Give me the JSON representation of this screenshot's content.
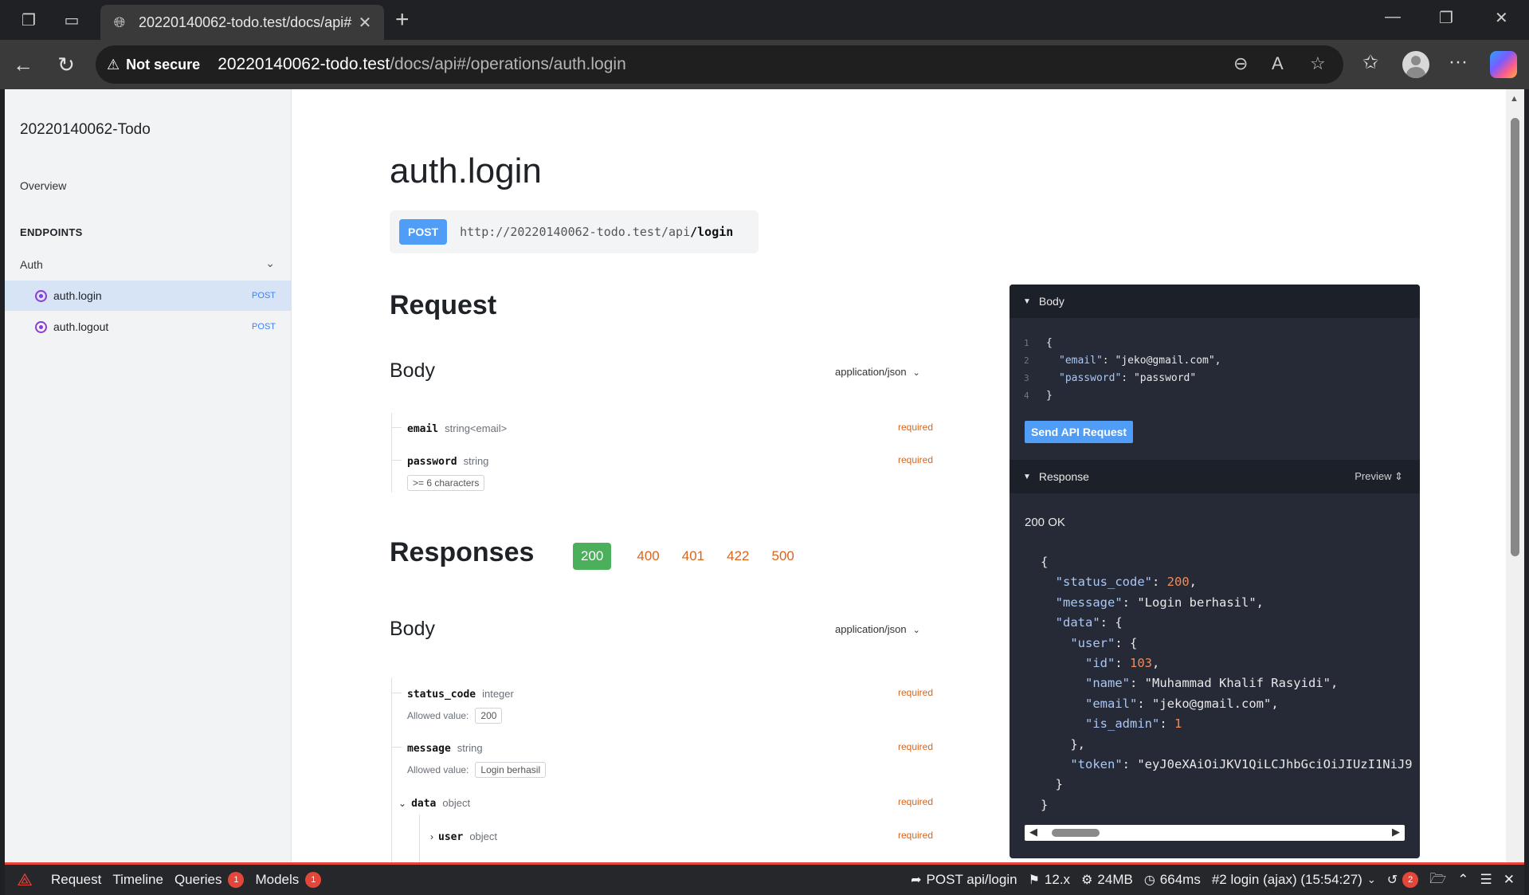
{
  "browser": {
    "tab_title": "20220140062-todo.test/docs/api#",
    "security": "Not secure",
    "url_host": "20220140062-todo.test",
    "url_path": "/docs/api#/operations/auth.login"
  },
  "sidebar": {
    "brand": "20220140062-Todo",
    "overview": "Overview",
    "endpoints_heading": "ENDPOINTS",
    "group": "Auth",
    "items": [
      {
        "label": "auth.login",
        "method": "POST"
      },
      {
        "label": "auth.logout",
        "method": "POST"
      }
    ]
  },
  "main": {
    "title": "auth.login",
    "method": "POST",
    "url_base": "http://20220140062-todo.test/api",
    "url_path": "/login",
    "request_heading": "Request",
    "body_heading": "Body",
    "content_type": "application/json",
    "request_fields": [
      {
        "name": "email",
        "type": "string<email>",
        "required": "required"
      },
      {
        "name": "password",
        "type": "string",
        "required": "required",
        "constraint": ">= 6 characters"
      }
    ],
    "responses_heading": "Responses",
    "status_codes": [
      "200",
      "400",
      "401",
      "422",
      "500"
    ],
    "response_body_heading": "Body",
    "response_content_type": "application/json",
    "allowed_value_label": "Allowed value:",
    "response_fields": [
      {
        "name": "status_code",
        "type": "integer",
        "required": "required",
        "allowed": "200"
      },
      {
        "name": "message",
        "type": "string",
        "required": "required",
        "allowed": "Login berhasil"
      },
      {
        "name": "data",
        "type": "object",
        "required": "required"
      },
      {
        "name": "user",
        "type": "object",
        "required": "required"
      }
    ]
  },
  "panel": {
    "body_label": "Body",
    "request_json": [
      {
        "ln": "1",
        "text": "{"
      },
      {
        "ln": "2",
        "key": "\"email\"",
        "value": "\"jeko@gmail.com\","
      },
      {
        "ln": "3",
        "key": "\"password\"",
        "value": "\"password\""
      },
      {
        "ln": "4",
        "text": "}"
      }
    ],
    "send_button": "Send API Request",
    "response_label": "Response",
    "preview_label": "Preview",
    "status": "200 OK",
    "response": {
      "status_code": "200",
      "message": "\"Login berhasil\"",
      "user_id": "103",
      "user_name": "\"Muhammad Khalif Rasyidi\"",
      "user_email": "\"jeko@gmail.com\"",
      "user_is_admin": "1",
      "token": "\"eyJ0eXAiOiJKV1QiLCJhbGciOiJIUzI1NiJ9"
    }
  },
  "debugbar": {
    "request": "Request",
    "timeline": "Timeline",
    "queries": "Queries",
    "queries_count": "1",
    "models": "Models",
    "models_count": "1",
    "route": "POST api/login",
    "version": "12.x",
    "memory": "24MB",
    "time": "664ms",
    "request_id": "#2 login (ajax) (15:54:27)",
    "history_count": "2"
  },
  "colors": {
    "accent": "#4f9df6",
    "required": "#d9651b",
    "success": "#4caf5c",
    "panel_bg": "#262a36"
  }
}
